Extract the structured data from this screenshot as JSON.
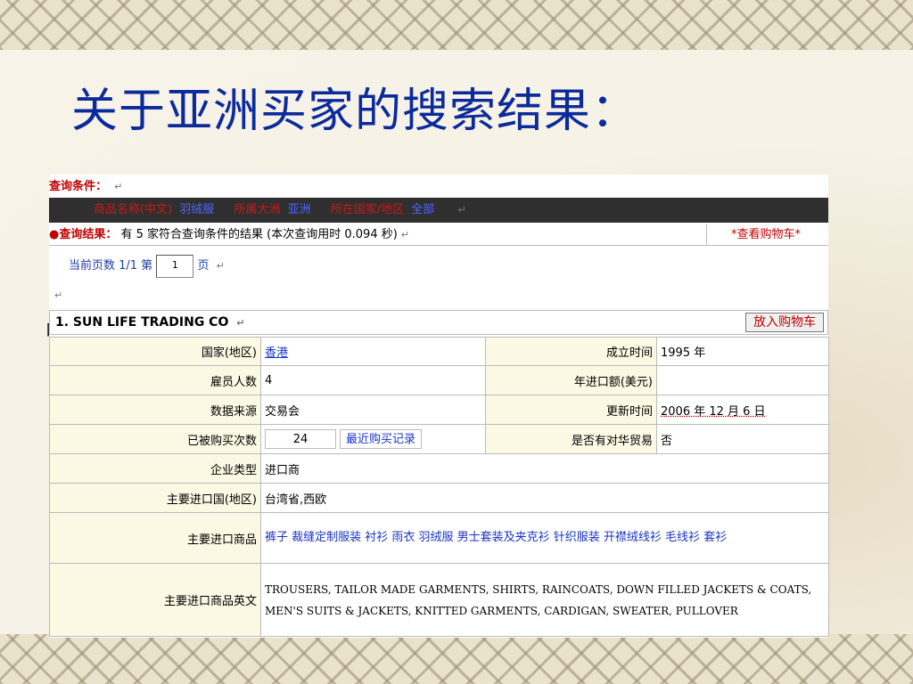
{
  "slide": {
    "title": "关于亚洲买家的搜索结果："
  },
  "return_mark": "↵",
  "query": {
    "label": "查询条件：",
    "product_name_label": "商品名称(中文)",
    "product_name_value": "羽绒服",
    "continent_label": "所属大洲",
    "continent_value": "亚洲",
    "country_label": "所在国家/地区",
    "country_value": "全部"
  },
  "result": {
    "label": "查询结果：",
    "summary": "有 5 家符合查询条件的结果  (本次查询用时 0.094 秒)",
    "cart_link": "*查看购物车*"
  },
  "pagination": {
    "prefix": "当前页数 1/1 第",
    "page_value": "1",
    "suffix": "页"
  },
  "company": {
    "name": "1. SUN LIFE TRADING CO",
    "add_to_cart": "放入购物车",
    "fields": {
      "country_label": "国家(地区)",
      "country_value": "香港",
      "founded_label": "成立时间",
      "founded_value": "1995 年",
      "employees_label": "雇员人数",
      "employees_value": "4",
      "import_amount_label": "年进口额(美元)",
      "import_amount_value": "",
      "source_label": "数据来源",
      "source_value": "交易会",
      "updated_label": "更新时间",
      "updated_value": "2006 年 12 月 6 日",
      "purchased_label": "已被购买次数",
      "purchased_value": "24",
      "recent_purchase_link": "最近购买记录",
      "china_trade_label": "是否有对华贸易",
      "china_trade_value": "否",
      "type_label": "企业类型",
      "type_value": "进口商",
      "main_import_countries_label": "主要进口国(地区)",
      "main_import_countries_value": "台湾省,西欧",
      "main_products_label": "主要进口商品",
      "main_products_value": "裤子 裁缝定制服装 衬衫 雨衣 羽绒服 男士套装及夹克衫 针织服装 开襟绒线衫 毛线衫 套衫",
      "main_products_en_label": "主要进口商品英文",
      "main_products_en_value": "TROUSERS, TAILOR MADE GARMENTS, SHIRTS, RAINCOATS, DOWN FILLED JACKETS & COATS, MEN'S SUITS & JACKETS, KNITTED GARMENTS, CARDIGAN, SWEATER, PULLOVER"
    }
  }
}
